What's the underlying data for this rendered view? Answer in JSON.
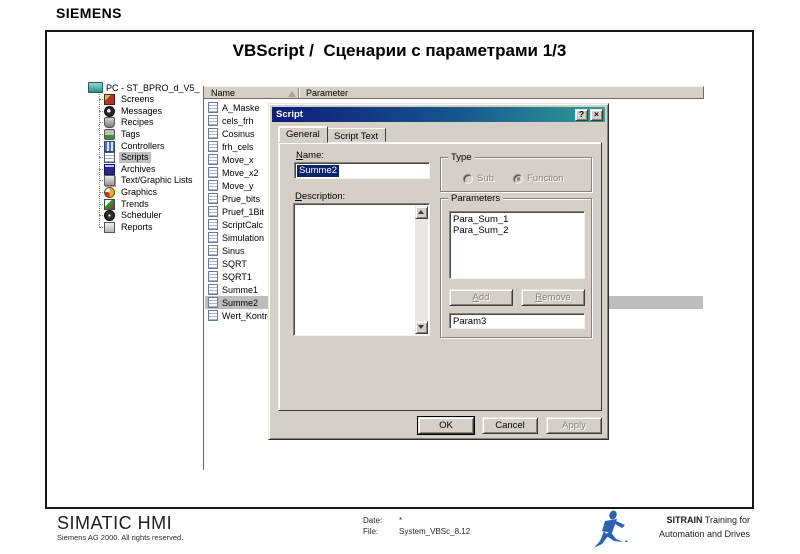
{
  "brand": "SIEMENS",
  "slide": {
    "title": "VBScript /  Сценарии с параметрами 1/3"
  },
  "tree": {
    "root": "PC - ST_BPRO_d_V5_",
    "items": [
      {
        "label": "Screens",
        "icon": "screens",
        "selected": false
      },
      {
        "label": "Messages",
        "icon": "messages",
        "selected": false
      },
      {
        "label": "Recipes",
        "icon": "recipes",
        "selected": false
      },
      {
        "label": "Tags",
        "icon": "tags",
        "selected": false
      },
      {
        "label": "Controllers",
        "icon": "controllers",
        "selected": false
      },
      {
        "label": "Scripts",
        "icon": "scripts",
        "selected": true
      },
      {
        "label": "Archives",
        "icon": "archives",
        "selected": false
      },
      {
        "label": "Text/Graphic Lists",
        "icon": "textlists",
        "selected": false
      },
      {
        "label": "Graphics",
        "icon": "graphics",
        "selected": false
      },
      {
        "label": "Trends",
        "icon": "trends",
        "selected": false
      },
      {
        "label": "Scheduler",
        "icon": "scheduler",
        "selected": false
      },
      {
        "label": "Reports",
        "icon": "reports",
        "selected": false
      }
    ]
  },
  "list": {
    "columns": [
      "Name",
      "Parameter"
    ],
    "items": [
      "A_Maske",
      "cels_frh",
      "Cosinus",
      "frh_cels",
      "Move_x",
      "Move_x2",
      "Move_y",
      "Prue_bits",
      "Pruef_1Bit",
      "ScriptCalc",
      "Simulation",
      "Sinus",
      "SQRT",
      "SQRT1",
      "Summe1",
      "Summe2",
      "Wert_Kontrol"
    ],
    "selected": "Summe2"
  },
  "dialog": {
    "title": "Script",
    "help_button": "?",
    "close_button": "×",
    "tabs": [
      "General",
      "Script Text"
    ],
    "active_tab": "General",
    "name_label": "Name:",
    "name_value": "Summe2",
    "type_group": {
      "label": "Type",
      "options": [
        {
          "label": "Sub",
          "selected": false
        },
        {
          "label": "Function",
          "selected": true
        }
      ]
    },
    "description_label": "Description:",
    "description_value": "",
    "parameters_group": {
      "label": "Parameters",
      "items": [
        "Para_Sum_1",
        "Para_Sum_2"
      ],
      "add_label": "Add",
      "remove_label": "Remove",
      "new_param_value": "Param3"
    },
    "buttons": {
      "ok": "OK",
      "cancel": "Cancel",
      "apply": "Apply"
    }
  },
  "footer": {
    "product": "SIMATIC HMI",
    "copyright": "Siemens AG 2000. All rights reserved.",
    "date_label": "Date:",
    "date_value": "*",
    "file_label": "File:",
    "file_value": "System_VBSc_8.12",
    "sitrain_bold": "SITRAIN",
    "sitrain_rest": " Training for",
    "sitrain_line2": "Automation and Drives"
  },
  "colors": {
    "chrome": "#d4d0c8",
    "titlebar_left": "#0e1d78",
    "titlebar_right": "#2f9e98",
    "selection": "#0a246a",
    "row_highlight": "#bdbdbd",
    "sitrain_blue": "#2e62b0"
  }
}
